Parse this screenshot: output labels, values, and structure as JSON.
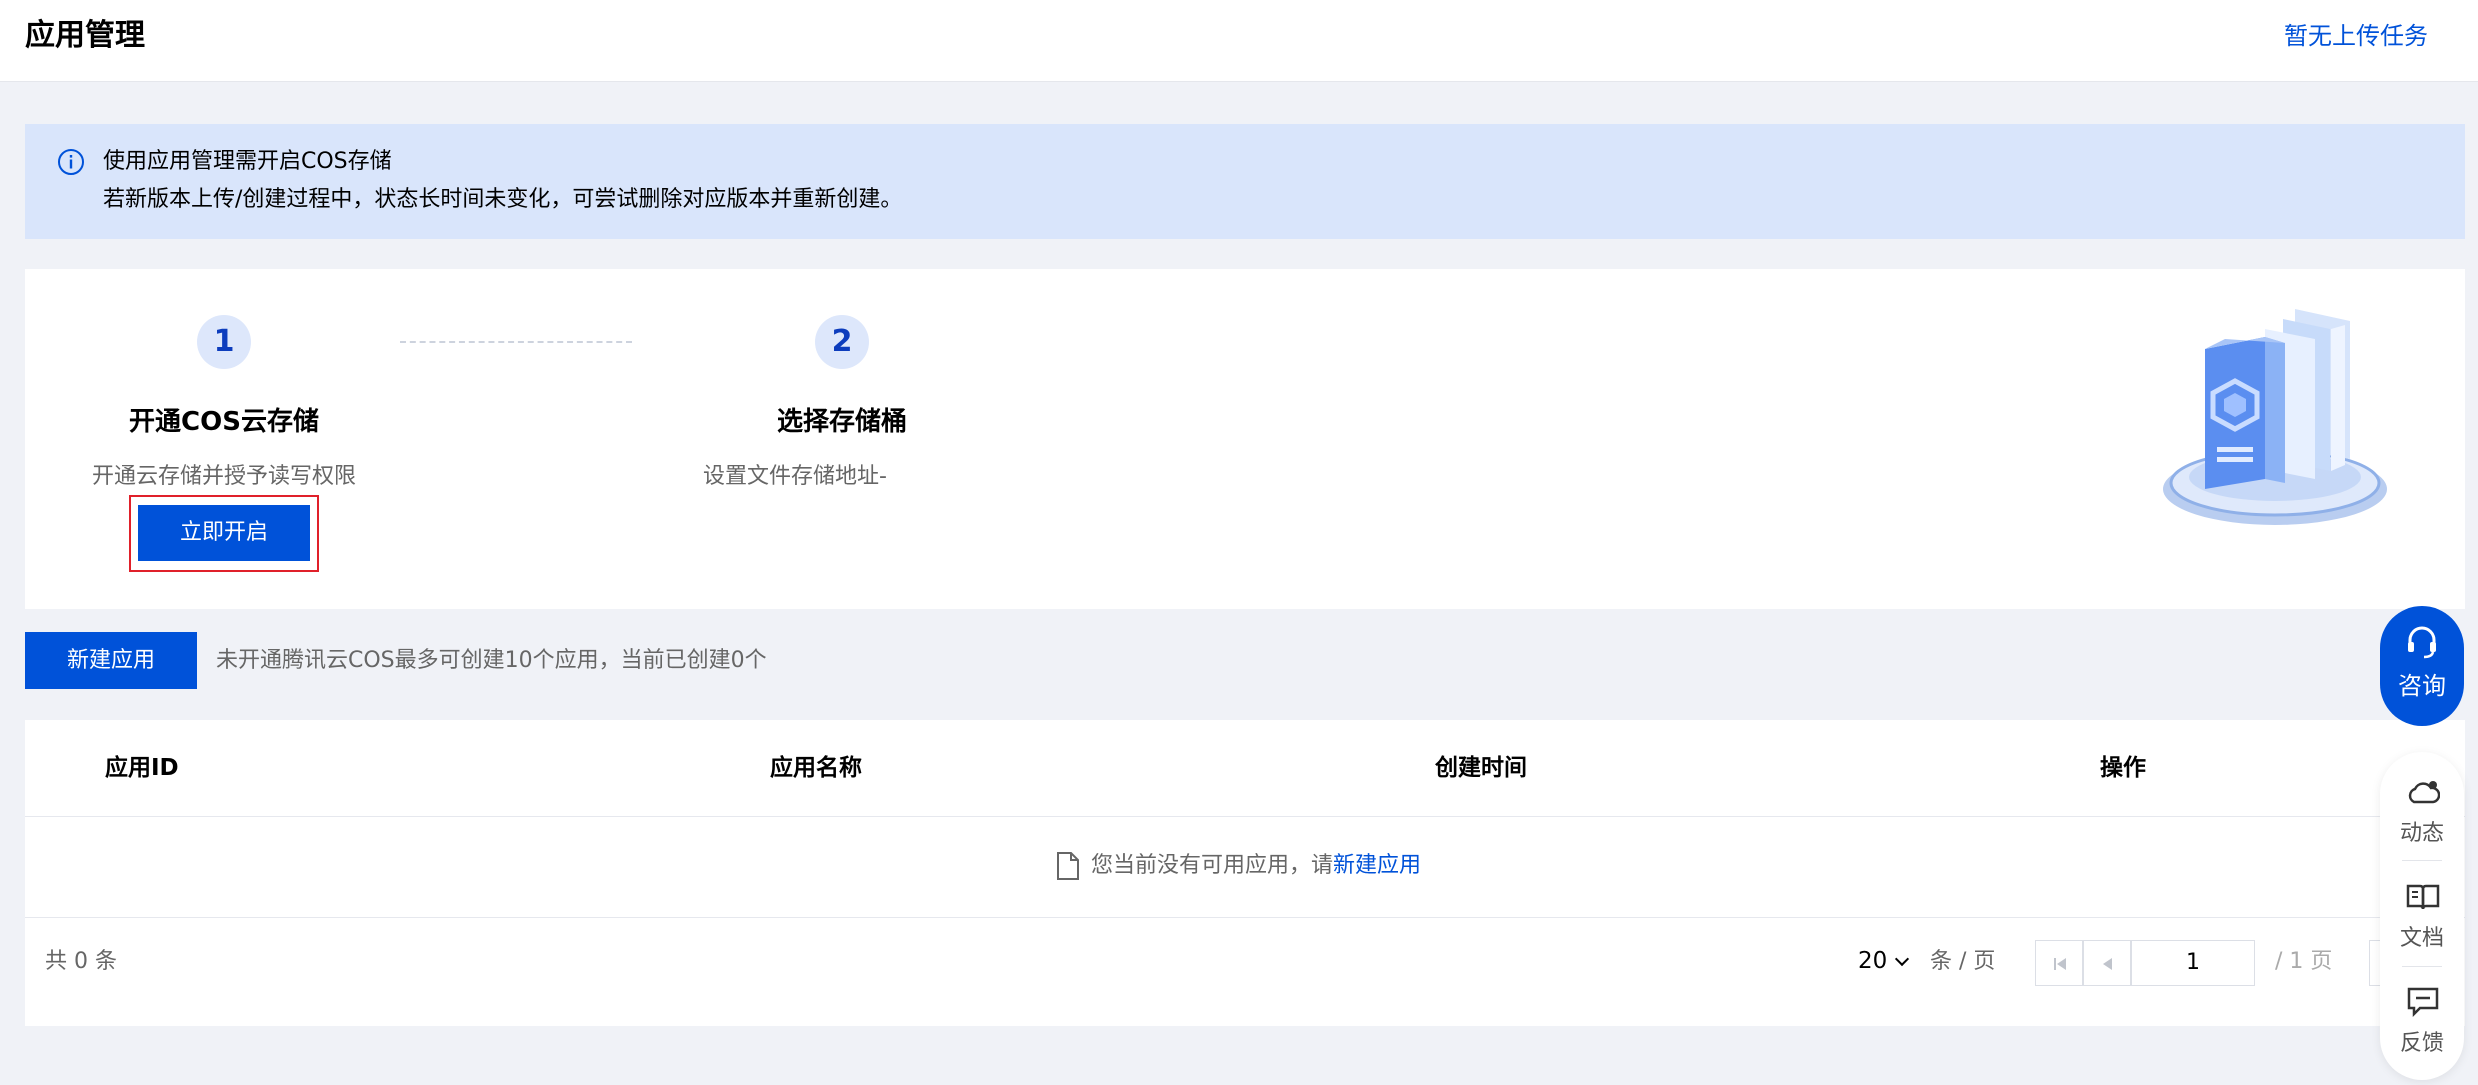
{
  "header": {
    "title": "应用管理",
    "upload_tasks": "暂无上传任务"
  },
  "notice": {
    "line1": "使用应用管理需开启COS存储",
    "line2": "若新版本上传/创建过程中，状态长时间未变化，可尝试删除对应版本并重新创建。"
  },
  "steps": [
    {
      "number": "1",
      "title": "开通COS云存储",
      "description": "开通云存储并授予读写权限",
      "action": "立即开启"
    },
    {
      "number": "2",
      "title": "选择存储桶",
      "description": "设置文件存储地址-"
    }
  ],
  "toolbar": {
    "create_label": "新建应用",
    "hint": "未开通腾讯云COS最多可创建10个应用，当前已创建0个"
  },
  "table": {
    "columns": [
      "应用ID",
      "应用名称",
      "创建时间",
      "操作"
    ],
    "empty_text": "您当前没有可用应用，请",
    "empty_link": "新建应用"
  },
  "pagination": {
    "total": "共 0 条",
    "page_size": "20",
    "per_page_label": "条 / 页",
    "current_page": "1",
    "total_pages": "/ 1 页"
  },
  "side": {
    "consult": "咨询",
    "items": [
      "动态",
      "文档",
      "反馈"
    ]
  },
  "colors": {
    "primary": "#0052d9",
    "notice_bg": "#d9e5fb",
    "highlight_outline": "#e0202a"
  }
}
